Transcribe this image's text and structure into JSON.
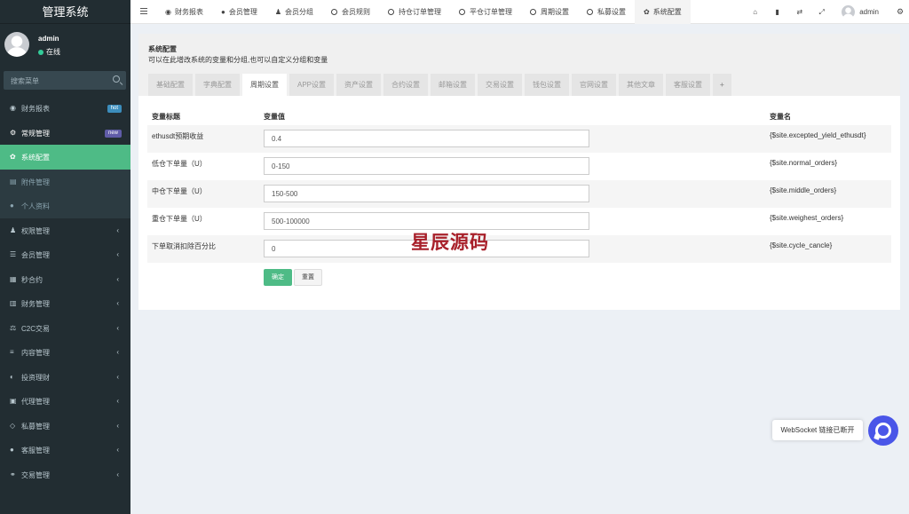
{
  "brand": "管理系统",
  "user": {
    "name": "admin",
    "status": "在线"
  },
  "search": {
    "placeholder": "搜索菜单"
  },
  "sidebar": {
    "items": [
      {
        "label": "财务报表",
        "icon": "dashboard-icon",
        "badge": "hot"
      },
      {
        "label": "常规管理",
        "icon": "cogs-icon",
        "badge": "new"
      },
      {
        "label": "系统配置",
        "icon": "gear-icon"
      },
      {
        "label": "附件管理",
        "icon": "file-image-icon"
      },
      {
        "label": "个人资料",
        "icon": "user-icon"
      },
      {
        "label": "权限管理",
        "icon": "group-icon",
        "arrow": "‹"
      },
      {
        "label": "会员管理",
        "icon": "list-icon",
        "arrow": "‹"
      },
      {
        "label": "秒合约",
        "icon": "calendar-icon",
        "arrow": "‹"
      },
      {
        "label": "财务管理",
        "icon": "database-icon",
        "arrow": "‹"
      },
      {
        "label": "C2C交易",
        "icon": "balance-scale-icon",
        "arrow": "‹"
      },
      {
        "label": "内容管理",
        "icon": "align-left-icon",
        "arrow": "‹"
      },
      {
        "label": "投资理财",
        "icon": "compass-icon",
        "arrow": "‹"
      },
      {
        "label": "代理管理",
        "icon": "briefcase-icon",
        "arrow": "‹"
      },
      {
        "label": "私募管理",
        "icon": "diamond-icon",
        "arrow": "‹"
      },
      {
        "label": "客服管理",
        "icon": "comment-icon",
        "arrow": "‹"
      },
      {
        "label": "交易管理",
        "icon": "handshake-icon",
        "arrow": "‹"
      }
    ]
  },
  "topnav": {
    "items": [
      {
        "label": "财务报表",
        "icon": "dashboard-icon"
      },
      {
        "label": "会员管理",
        "icon": "user-icon"
      },
      {
        "label": "会员分组",
        "icon": "users-icon"
      },
      {
        "label": "会员规则",
        "icon": "circle-icon"
      },
      {
        "label": "持仓订单管理",
        "icon": "circle-icon"
      },
      {
        "label": "平仓订单管理",
        "icon": "circle-icon"
      },
      {
        "label": "周期设置",
        "icon": "circle-icon"
      },
      {
        "label": "私募设置",
        "icon": "circle-icon"
      },
      {
        "label": "系统配置",
        "icon": "gear-icon"
      }
    ],
    "admin_name": "admin"
  },
  "page": {
    "title": "系统配置",
    "description": "可以在此增改系统的变量和分组,也可以自定义分组和变量",
    "tabs": [
      "基础配置",
      "字典配置",
      "周期设置",
      "APP设置",
      "资产设置",
      "合约设置",
      "邮箱设置",
      "交易设置",
      "钱包设置",
      "官网设置",
      "其他文章",
      "客服设置"
    ],
    "active_tab": "周期设置",
    "add_tab": "+"
  },
  "table": {
    "headers": {
      "title": "变量标题",
      "value": "变量值",
      "name": "变量名"
    },
    "rows": [
      {
        "title": "ethusdt预期收益",
        "value": "0.4",
        "name": "{$site.excepted_yield_ethusdt}"
      },
      {
        "title": "低仓下单量（U）",
        "value": "0-150",
        "name": "{$site.normal_orders}"
      },
      {
        "title": "中仓下单量（U）",
        "value": "150-500",
        "name": "{$site.middle_orders}"
      },
      {
        "title": "重仓下单量（U）",
        "value": "500-100000",
        "name": "{$site.weighest_orders}"
      },
      {
        "title": "下单取消扣除百分比",
        "value": "0",
        "name": "{$site.cycle_cancle}"
      }
    ]
  },
  "buttons": {
    "confirm": "确定",
    "reset": "重置"
  },
  "watermark": "星辰源码",
  "notification": {
    "text": "WebSocket 链接已断开"
  },
  "colors": {
    "accent": "#4ebb86",
    "sidebar_bg": "#222d32",
    "chat_button": "#4a56e8"
  }
}
